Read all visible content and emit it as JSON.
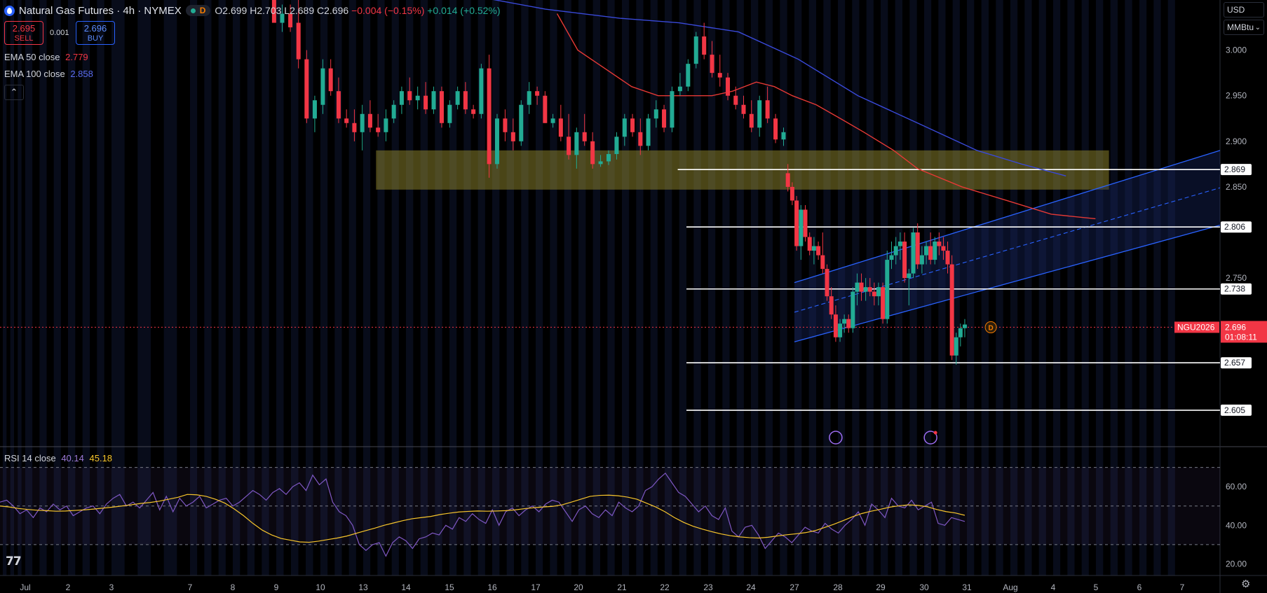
{
  "header": {
    "symbol_title": "Natural Gas Futures · 4h · NYMEX",
    "market_flag": "D",
    "open": "O2.699",
    "high": "H2.703",
    "low": "L2.689",
    "close": "C2.696",
    "change": "−0.004 (−0.15%)",
    "extra_change": "+0.014 (+0.52%)"
  },
  "trade": {
    "sell_price": "2.695",
    "sell_label": "SELL",
    "spread": "0.001",
    "buy_price": "2.696",
    "buy_label": "BUY"
  },
  "indicators": {
    "ema50_label": "EMA 50 close",
    "ema50_value": "2.779",
    "ema100_label": "EMA 100 close",
    "ema100_value": "2.858",
    "collapse_icon": "chevron-up-icon",
    "rsi_label": "RSI 14 close",
    "rsi_value": "40.14",
    "rsi_ma_value": "45.18"
  },
  "price_axis": {
    "currency": "USD",
    "unit": "MMBtu",
    "ticks": [
      "3.000",
      "2.950",
      "2.900",
      "2.850",
      "2.750"
    ],
    "partial_ticks": [
      "2.800",
      "2.700",
      "2.650"
    ],
    "level_labels": [
      "2.869",
      "2.806",
      "2.738",
      "2.657",
      "2.605"
    ],
    "symbol_badge": "NGU2026",
    "last_price": "2.696",
    "countdown": "01:08:11"
  },
  "rsi_axis": {
    "ticks": [
      "60.00",
      "40.00",
      "20.00"
    ]
  },
  "time_axis": {
    "labels": [
      "Jul",
      "2",
      "3",
      "7",
      "8",
      "9",
      "10",
      "13",
      "14",
      "15",
      "16",
      "17",
      "20",
      "21",
      "22",
      "23",
      "24",
      "27",
      "28",
      "29",
      "30",
      "31",
      "Aug",
      "4",
      "5",
      "6",
      "7"
    ]
  },
  "colors": {
    "up": "#22ab94",
    "down": "#f23645",
    "ema50": "#e53935",
    "ema100": "#3949d8",
    "rsi": "#7e57c2",
    "rsi_ma": "#f7c52b",
    "channel": "#2962ff",
    "zone": "#a59a32",
    "levels": "#ffffff"
  },
  "chart_data": {
    "type": "candlestick",
    "title": "Natural Gas Futures · 4h · NYMEX",
    "ylim": [
      2.565,
      3.055
    ],
    "x_range": [
      "Jul 1",
      "Aug 7"
    ],
    "grid": false,
    "horizontal_levels": [
      2.869,
      2.806,
      2.738,
      2.657,
      2.605
    ],
    "resistance_zone": {
      "from": 2.847,
      "to": 2.89,
      "x_start": "Jul 10",
      "x_end": "Aug 6"
    },
    "last_price": 2.696,
    "candles": [
      [
        3.06,
        3.07,
        3.03,
        3.03
      ],
      [
        3.03,
        3.05,
        3.02,
        3.04
      ],
      [
        3.04,
        3.05,
        3.02,
        3.025
      ],
      [
        3.03,
        3.06,
        2.98,
        2.99
      ],
      [
        2.99,
        3.0,
        2.92,
        2.925
      ],
      [
        2.925,
        2.95,
        2.91,
        2.945
      ],
      [
        2.94,
        2.99,
        2.93,
        2.98
      ],
      [
        2.98,
        2.99,
        2.95,
        2.955
      ],
      [
        2.955,
        2.97,
        2.92,
        2.925
      ],
      [
        2.925,
        2.935,
        2.915,
        2.92
      ],
      [
        2.92,
        2.935,
        2.9,
        2.91
      ],
      [
        2.91,
        2.94,
        2.89,
        2.93
      ],
      [
        2.93,
        2.945,
        2.91,
        2.915
      ],
      [
        2.915,
        2.93,
        2.905,
        2.91
      ],
      [
        2.91,
        2.935,
        2.9,
        2.925
      ],
      [
        2.925,
        2.945,
        2.92,
        2.94
      ],
      [
        2.94,
        2.96,
        2.93,
        2.955
      ],
      [
        2.955,
        2.97,
        2.94,
        2.945
      ],
      [
        2.945,
        2.96,
        2.935,
        2.95
      ],
      [
        2.95,
        2.965,
        2.93,
        2.935
      ],
      [
        2.935,
        2.96,
        2.93,
        2.955
      ],
      [
        2.955,
        2.96,
        2.915,
        2.92
      ],
      [
        2.92,
        2.945,
        2.915,
        2.94
      ],
      [
        2.94,
        2.96,
        2.935,
        2.955
      ],
      [
        2.955,
        2.965,
        2.93,
        2.935
      ],
      [
        2.935,
        2.94,
        2.925,
        2.93
      ],
      [
        2.93,
        2.985,
        2.925,
        2.98
      ],
      [
        2.98,
        2.995,
        2.86,
        2.875
      ],
      [
        2.875,
        2.93,
        2.87,
        2.925
      ],
      [
        2.925,
        2.935,
        2.9,
        2.91
      ],
      [
        2.91,
        2.925,
        2.89,
        2.9
      ],
      [
        2.9,
        2.945,
        2.895,
        2.94
      ],
      [
        2.94,
        2.965,
        2.93,
        2.955
      ],
      [
        2.955,
        2.96,
        2.94,
        2.95
      ],
      [
        2.95,
        2.955,
        2.92,
        2.92
      ],
      [
        2.92,
        2.93,
        2.915,
        2.925
      ],
      [
        2.925,
        2.94,
        2.9,
        2.905
      ],
      [
        2.905,
        2.93,
        2.88,
        2.885
      ],
      [
        2.885,
        2.915,
        2.87,
        2.91
      ],
      [
        2.91,
        2.93,
        2.895,
        2.9
      ],
      [
        2.9,
        2.91,
        2.87,
        2.875
      ],
      [
        2.875,
        2.885,
        2.872,
        2.878
      ],
      [
        2.878,
        2.89,
        2.874,
        2.886
      ],
      [
        2.886,
        2.91,
        2.88,
        2.905
      ],
      [
        2.905,
        2.93,
        2.895,
        2.925
      ],
      [
        2.925,
        2.93,
        2.905,
        2.91
      ],
      [
        2.91,
        2.925,
        2.885,
        2.895
      ],
      [
        2.895,
        2.93,
        2.89,
        2.925
      ],
      [
        2.925,
        2.945,
        2.915,
        2.935
      ],
      [
        2.935,
        2.94,
        2.91,
        2.915
      ],
      [
        2.915,
        2.96,
        2.91,
        2.955
      ],
      [
        2.955,
        2.975,
        2.95,
        2.96
      ],
      [
        2.96,
        2.99,
        2.955,
        2.985
      ],
      [
        2.985,
        3.02,
        2.98,
        3.015
      ],
      [
        3.015,
        3.03,
        2.99,
        2.995
      ],
      [
        2.995,
        3.01,
        2.97,
        2.975
      ],
      [
        2.975,
        2.995,
        2.96,
        2.97
      ],
      [
        2.97,
        2.975,
        2.945,
        2.95
      ],
      [
        2.95,
        2.96,
        2.935,
        2.94
      ],
      [
        2.94,
        2.95,
        2.925,
        2.93
      ],
      [
        2.93,
        2.945,
        2.91,
        2.915
      ],
      [
        2.915,
        2.95,
        2.905,
        2.945
      ],
      [
        2.945,
        2.96,
        2.92,
        2.925
      ],
      [
        2.925,
        2.93,
        2.898,
        2.902
      ],
      [
        2.902,
        2.915,
        2.895,
        2.91
      ],
      [
        2.865,
        2.875,
        2.845,
        2.85
      ],
      [
        2.85,
        2.855,
        2.83,
        2.835
      ],
      [
        2.835,
        2.84,
        2.78,
        2.785
      ],
      [
        2.785,
        2.83,
        2.77,
        2.825
      ],
      [
        2.825,
        2.83,
        2.79,
        2.795
      ],
      [
        2.795,
        2.8,
        2.775,
        2.78
      ],
      [
        2.78,
        2.795,
        2.765,
        2.785
      ],
      [
        2.785,
        2.79,
        2.77,
        2.775
      ],
      [
        2.775,
        2.8,
        2.755,
        2.76
      ],
      [
        2.76,
        2.765,
        2.725,
        2.73
      ],
      [
        2.73,
        2.74,
        2.705,
        2.71
      ],
      [
        2.71,
        2.72,
        2.68,
        2.685
      ],
      [
        2.685,
        2.705,
        2.68,
        2.7
      ],
      [
        2.7,
        2.71,
        2.69,
        2.705
      ],
      [
        2.705,
        2.71,
        2.69,
        2.695
      ],
      [
        2.695,
        2.74,
        2.69,
        2.735
      ],
      [
        2.735,
        2.755,
        2.72,
        2.745
      ],
      [
        2.745,
        2.755,
        2.725,
        2.735
      ],
      [
        2.735,
        2.75,
        2.725,
        2.74
      ],
      [
        2.74,
        2.75,
        2.73,
        2.735
      ],
      [
        2.735,
        2.745,
        2.72,
        2.73
      ],
      [
        2.73,
        2.745,
        2.72,
        2.74
      ],
      [
        2.74,
        2.745,
        2.7,
        2.705
      ],
      [
        2.705,
        2.78,
        2.7,
        2.77
      ],
      [
        2.77,
        2.79,
        2.76,
        2.775
      ],
      [
        2.775,
        2.795,
        2.765,
        2.785
      ],
      [
        2.785,
        2.8,
        2.77,
        2.79
      ],
      [
        2.79,
        2.8,
        2.745,
        2.75
      ],
      [
        2.75,
        2.76,
        2.72,
        2.755
      ],
      [
        2.755,
        2.805,
        2.75,
        2.8
      ],
      [
        2.8,
        2.81,
        2.76,
        2.765
      ],
      [
        2.765,
        2.785,
        2.755,
        2.775
      ],
      [
        2.775,
        2.79,
        2.765,
        2.785
      ],
      [
        2.785,
        2.8,
        2.765,
        2.77
      ],
      [
        2.77,
        2.795,
        2.765,
        2.79
      ],
      [
        2.79,
        2.8,
        2.775,
        2.785
      ],
      [
        2.785,
        2.795,
        2.77,
        2.78
      ],
      [
        2.78,
        2.79,
        2.755,
        2.765
      ],
      [
        2.765,
        2.775,
        2.66,
        2.665
      ],
      [
        2.665,
        2.69,
        2.655,
        2.685
      ],
      [
        2.685,
        2.7,
        2.675,
        2.695
      ],
      [
        2.695,
        2.705,
        2.685,
        2.699
      ]
    ],
    "ema50": [
      [
        2.79,
        3.04
      ],
      [
        2.86,
        3.0
      ],
      [
        2.95,
        2.98
      ],
      [
        3.04,
        2.96
      ],
      [
        3.13,
        2.95
      ],
      [
        3.22,
        2.95
      ],
      [
        3.31,
        2.95
      ],
      [
        3.38,
        2.955
      ],
      [
        3.46,
        2.965
      ],
      [
        3.52,
        2.96
      ],
      [
        3.58,
        2.95
      ],
      [
        3.66,
        2.94
      ],
      [
        3.74,
        2.925
      ],
      [
        3.82,
        2.91
      ],
      [
        3.92,
        2.89
      ],
      [
        4.0,
        2.87
      ],
      [
        4.15,
        2.85
      ],
      [
        4.3,
        2.835
      ],
      [
        4.45,
        2.82
      ],
      [
        4.6,
        2.815
      ]
    ],
    "ema100": [
      [
        2.3,
        3.07
      ],
      [
        2.5,
        3.06
      ],
      [
        2.75,
        3.045
      ],
      [
        3.0,
        3.035
      ],
      [
        3.2,
        3.03
      ],
      [
        3.4,
        3.02
      ],
      [
        3.6,
        2.99
      ],
      [
        3.8,
        2.95
      ],
      [
        4.0,
        2.92
      ],
      [
        4.2,
        2.89
      ],
      [
        4.35,
        2.875
      ],
      [
        4.5,
        2.862
      ]
    ],
    "regression_channel": {
      "start": "Jul 28",
      "end": "Aug 7",
      "lower": [
        2.68,
        2.808
      ],
      "upper": [
        2.745,
        2.89
      ]
    },
    "rsi": {
      "ylim": [
        14,
        80
      ],
      "bands": [
        30,
        50,
        70
      ],
      "values": [
        52,
        53,
        50,
        46,
        48,
        44,
        49,
        47,
        51,
        48,
        50,
        45,
        47,
        49,
        50,
        46,
        51,
        54,
        56,
        50,
        52,
        49,
        53,
        57,
        48,
        55,
        47,
        54,
        50,
        52,
        55,
        49,
        51,
        53,
        54,
        50,
        52,
        55,
        58,
        56,
        53,
        57,
        59,
        56,
        60,
        62,
        58,
        66,
        61,
        64,
        52,
        47,
        45,
        40,
        30,
        27,
        30,
        31,
        24,
        31,
        34,
        32,
        28,
        33,
        34,
        36,
        35,
        40,
        38,
        44,
        42,
        46,
        43,
        41,
        48,
        40,
        47,
        49,
        45,
        48,
        50,
        47,
        51,
        53,
        52,
        47,
        42,
        48,
        50,
        46,
        44,
        48,
        45,
        52,
        49,
        47,
        50,
        58,
        60,
        64,
        67,
        62,
        57,
        55,
        51,
        47,
        50,
        45,
        43,
        49,
        37,
        34,
        39,
        40,
        35,
        28,
        32,
        36,
        34,
        31,
        35,
        39,
        37,
        36,
        41,
        38,
        36,
        40,
        43,
        47,
        40,
        51,
        48,
        44,
        54,
        50,
        49,
        53,
        48,
        50,
        52,
        41,
        40,
        44,
        43,
        42
      ],
      "ma": [
        50,
        49.5,
        48.7,
        48.2,
        47.8,
        47.6,
        47.3,
        47.4,
        47.7,
        48.0,
        48.4,
        48.9,
        49.4,
        50.0,
        50.6,
        51.3,
        51.8,
        52.5,
        53.5,
        54.5,
        56,
        55.8,
        55,
        53.5,
        51.5,
        48.5,
        45,
        41,
        37.5,
        35,
        33.2,
        32.3,
        31.4,
        31.2,
        31.8,
        32.6,
        33.4,
        34.4,
        35.8,
        37.2,
        38.5,
        40,
        41.2,
        42.4,
        43.4,
        44,
        44.6,
        45.6,
        46.3,
        46.9,
        47.2,
        47.4,
        47.3,
        47.4,
        47.6,
        48,
        48.6,
        49.1,
        49.5,
        49.8,
        50.6,
        52,
        53.5,
        55,
        55.5,
        55.6,
        55.3,
        54.6,
        53.5,
        51.5,
        49.5,
        47,
        44,
        41.5,
        39.5,
        38,
        36.7,
        35.5,
        34.6,
        34,
        33.6,
        33.4,
        33.8,
        34.5,
        35.1,
        35.6,
        36.2,
        37.2,
        38.8,
        40.5,
        42.4,
        44.4,
        46.1,
        47.3,
        48.3,
        49.4,
        50.1,
        50.6,
        50.3,
        49.6,
        48.2,
        47.1,
        46.4,
        45.18
      ]
    }
  }
}
